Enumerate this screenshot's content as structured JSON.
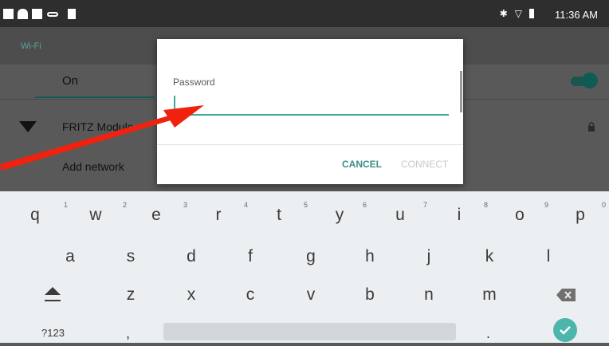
{
  "status_bar": {
    "time": "11:36 AM",
    "icons": [
      "notification-icon",
      "notification-icon",
      "notification-icon",
      "voicemail-icon",
      "sd-card-icon",
      "bluetooth-icon",
      "wifi-signal-icon",
      "battery-icon"
    ]
  },
  "settings": {
    "title": "Wi-Fi",
    "on_label": "On",
    "toggle_on": true,
    "networks": [
      {
        "name": "FRITZ Module",
        "secured": true
      }
    ],
    "add_network_label": "Add network"
  },
  "dialog": {
    "password_label": "Password",
    "password_value": "",
    "cancel_label": "CANCEL",
    "connect_label": "CONNECT",
    "accent_color": "#41a69b"
  },
  "keyboard": {
    "row1": [
      {
        "key": "q",
        "hint": "1"
      },
      {
        "key": "w",
        "hint": "2"
      },
      {
        "key": "e",
        "hint": "3"
      },
      {
        "key": "r",
        "hint": "4"
      },
      {
        "key": "t",
        "hint": "5"
      },
      {
        "key": "y",
        "hint": "6"
      },
      {
        "key": "u",
        "hint": "7"
      },
      {
        "key": "i",
        "hint": "8"
      },
      {
        "key": "o",
        "hint": "9"
      },
      {
        "key": "p",
        "hint": "0"
      }
    ],
    "row2": [
      "a",
      "s",
      "d",
      "f",
      "g",
      "h",
      "j",
      "k",
      "l"
    ],
    "row3": [
      "z",
      "x",
      "c",
      "v",
      "b",
      "n",
      "m"
    ],
    "symbols_label": "?123",
    "comma_label": ",",
    "period_label": "."
  }
}
